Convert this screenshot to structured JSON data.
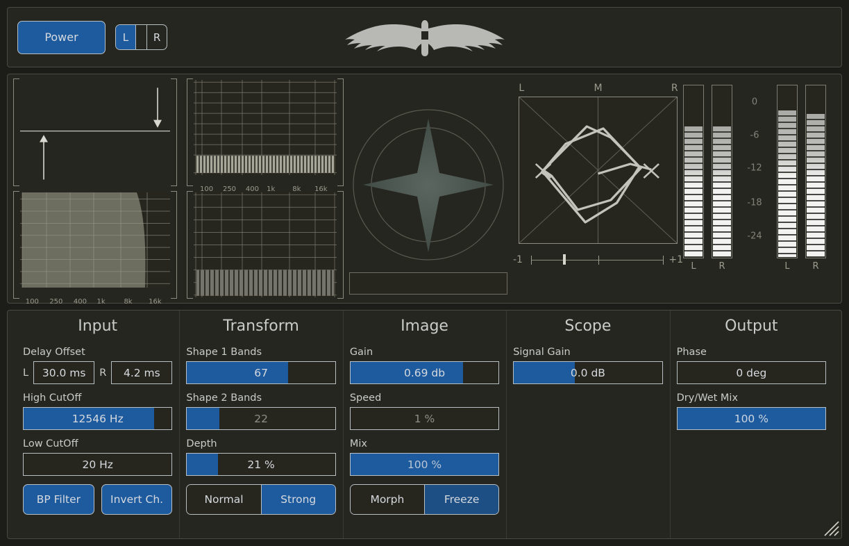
{
  "header": {
    "power_label": "Power",
    "channel_toggle": [
      {
        "label": "L",
        "active": true
      },
      {
        "label": "",
        "active": false
      },
      {
        "label": "R",
        "active": false
      }
    ],
    "logo": "eagle-logo"
  },
  "display": {
    "freq_ticks": [
      "100",
      "250",
      "400",
      "1k",
      "8k",
      "16k"
    ],
    "goniometer": {
      "axis_labels": [
        "L",
        "M",
        "R"
      ],
      "correlation_min": "-1",
      "correlation_max": "+1",
      "correlation_value": -0.45
    },
    "meters": {
      "scale_labels": [
        "0",
        "-6",
        "-12",
        "-18",
        "-24"
      ],
      "channels": [
        {
          "label": "L",
          "level": 0.76
        },
        {
          "label": "R",
          "level": 0.76
        },
        {
          "label": "L",
          "level": 0.85
        },
        {
          "label": "R",
          "level": 0.83
        }
      ]
    }
  },
  "controls": {
    "columns": [
      {
        "title": "Input",
        "delay_offset_label": "Delay Offset",
        "delay_l_tag": "L",
        "delay_l_value": "30.0 ms",
        "delay_r_tag": "R",
        "delay_r_value": "4.2 ms",
        "high_cutoff_label": "High CutOff",
        "high_cutoff_value": "12546 Hz",
        "high_cutoff_fill": 88,
        "low_cutoff_label": "Low CutOff",
        "low_cutoff_value": "20 Hz",
        "low_cutoff_fill": 0,
        "button_1": "BP Filter",
        "button_2": "Invert Ch."
      },
      {
        "title": "Transform",
        "shape1_label": "Shape 1 Bands",
        "shape1_value": "67",
        "shape1_fill": 68,
        "shape2_label": "Shape 2 Bands",
        "shape2_value": "22",
        "shape2_fill": 22,
        "depth_label": "Depth",
        "depth_value": "21 %",
        "depth_fill": 21,
        "seg_1": "Normal",
        "seg_2": "Strong",
        "seg_active": 1
      },
      {
        "title": "Image",
        "gain_label": "Gain",
        "gain_value": "0.69 db",
        "gain_fill": 76,
        "speed_label": "Speed",
        "speed_value": "1 %",
        "speed_fill": 0,
        "mix_label": "Mix",
        "mix_value": "100 %",
        "mix_fill": 100,
        "seg_1": "Morph",
        "seg_2": "Freeze",
        "seg_active": 1
      },
      {
        "title": "Scope",
        "signal_gain_label": "Signal Gain",
        "signal_gain_value": "0.0 dB",
        "signal_gain_fill": 41
      },
      {
        "title": "Output",
        "phase_label": "Phase",
        "phase_value": "0 deg",
        "phase_fill": 0,
        "drywet_label": "Dry/Wet Mix",
        "drywet_value": "100 %",
        "drywet_fill": 100
      }
    ]
  },
  "colors": {
    "accent_blue": "#1d5a9e",
    "panel_bg": "#262620",
    "app_bg": "#1c1c19",
    "border": "#4a4a42",
    "text": "#c9ccc8"
  }
}
